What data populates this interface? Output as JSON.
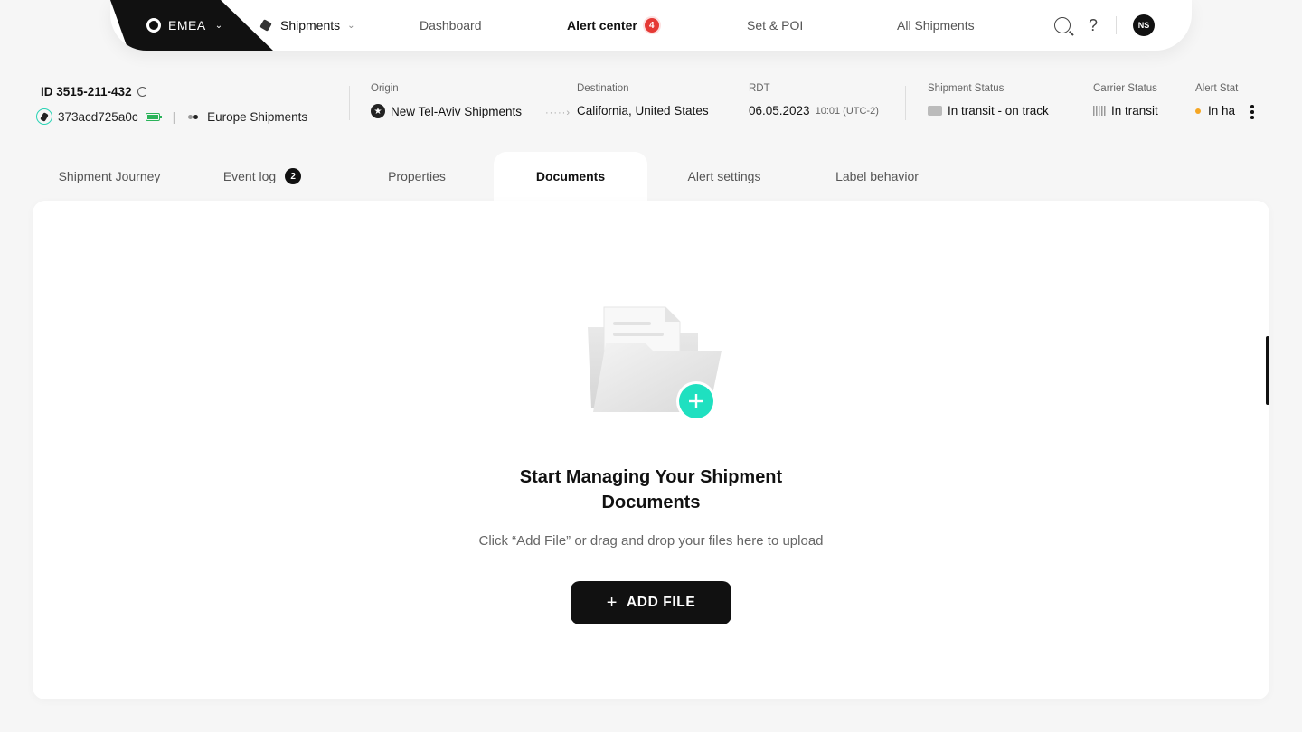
{
  "nav": {
    "region": "EMEA",
    "shipments": "Shipments",
    "dashboard": "Dashboard",
    "alert_center": "Alert center",
    "alert_count": "4",
    "set_poi": "Set & POI",
    "all_shipments": "All Shipments",
    "help": "?",
    "user_initials": "NS"
  },
  "shipment": {
    "id": "ID 3515-211-432",
    "tag_id": "373acd725a0c",
    "group": "Europe Shipments",
    "origin_label": "Origin",
    "origin": "New Tel-Aviv Shipments",
    "destination_label": "Destination",
    "destination": "California, United States",
    "rdt_label": "RDT",
    "rdt_date": "06.05.2023",
    "rdt_time": "10:01 (UTC-2)",
    "shipment_status_label": "Shipment Status",
    "shipment_status": "In transit - on track",
    "carrier_status_label": "Carrier Status",
    "carrier_status": "In transit",
    "alert_status_label": "Alert Stat",
    "alert_status": "In ha"
  },
  "tabs": {
    "journey": "Shipment Journey",
    "event_log": "Event log",
    "event_count": "2",
    "properties": "Properties",
    "documents": "Documents",
    "alert_settings": "Alert settings",
    "label_behavior": "Label behavior"
  },
  "documents": {
    "title_line1": "Start Managing Your Shipment",
    "title_line2": "Documents",
    "description": "Click “Add File” or drag and drop your files here to upload",
    "add_button": "ADD FILE"
  },
  "colors": {
    "accent": "#1fe0c0",
    "alert_badge": "#e53935",
    "battery": "#2bb35a",
    "alert_dot": "#f5a623"
  }
}
